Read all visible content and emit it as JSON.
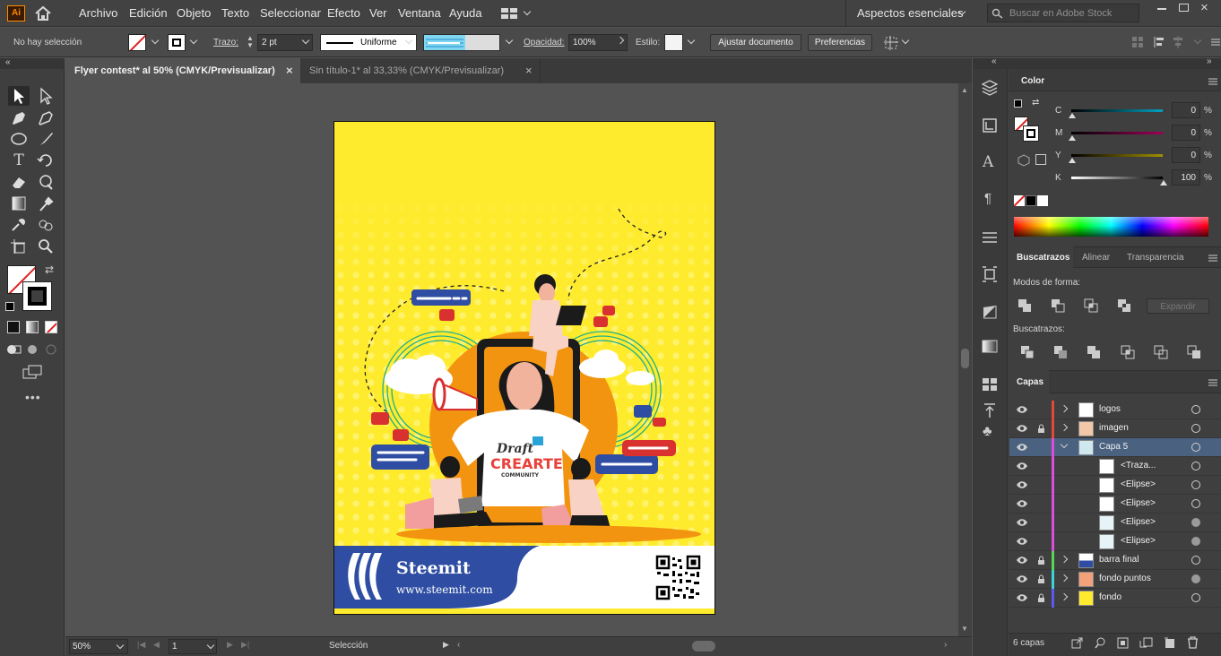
{
  "menubar": {
    "app_logo": "Ai",
    "menus": [
      "Archivo",
      "Edición",
      "Objeto",
      "Texto",
      "Seleccionar",
      "Efecto",
      "Ver",
      "Ventana",
      "Ayuda"
    ],
    "workspace": "Aspectos esenciales",
    "search_placeholder": "Buscar en Adobe Stock"
  },
  "control": {
    "selection": "No hay selección",
    "stroke_label": "Trazo:",
    "stroke_weight": "2 pt",
    "stroke_profile": "Uniforme",
    "opacity_label": "Opacidad:",
    "opacity_value": "100%",
    "style_label": "Estilo:",
    "adjust_button": "Ajustar documento",
    "prefs_button": "Preferencias"
  },
  "tabs": [
    {
      "label": "Flyer contest* al 50% (CMYK/Previsualizar)",
      "close": "×"
    },
    {
      "label": "Sin título-1* al 33,33% (CMYK/Previsualizar)",
      "close": "×"
    }
  ],
  "artwork": {
    "brand": "Steemit",
    "url": "www.steemit.com",
    "shirt_line1": "Draft",
    "shirt_line2": "CREARTE",
    "shirt_line3": "COMMUNITY"
  },
  "status": {
    "zoom": "50%",
    "page": "1",
    "tool": "Selección"
  },
  "color_panel": {
    "title": "Color",
    "channels": [
      {
        "label": "C",
        "value": "0",
        "unit": "%"
      },
      {
        "label": "M",
        "value": "0",
        "unit": "%"
      },
      {
        "label": "Y",
        "value": "0",
        "unit": "%"
      },
      {
        "label": "K",
        "value": "100",
        "unit": "%"
      }
    ]
  },
  "pathfinder": {
    "tabs": [
      "Buscatrazos",
      "Alinear",
      "Transparencia"
    ],
    "shape_modes": "Modos de forma:",
    "expand": "Expandir",
    "pathfinders": "Buscatrazos:"
  },
  "layers": {
    "title": "Capas",
    "count": "6 capas",
    "items": [
      {
        "name": "logos",
        "color": "#e04a3a"
      },
      {
        "name": "imagen",
        "color": "#e04a3a"
      },
      {
        "name": "Capa 5",
        "color": "#d94fd9"
      },
      {
        "name": "<Traza...",
        "color": "#d94fd9"
      },
      {
        "name": "<Elipse>",
        "color": "#d94fd9"
      },
      {
        "name": "<Elipse>",
        "color": "#d94fd9"
      },
      {
        "name": "<Elipse>",
        "color": "#d94fd9"
      },
      {
        "name": "<Elipse>",
        "color": "#d94fd9"
      },
      {
        "name": "barra final",
        "color": "#56d656"
      },
      {
        "name": "fondo puntos",
        "color": "#3fd2d2"
      },
      {
        "name": "fondo",
        "color": "#5a5af0"
      }
    ]
  },
  "colors": {
    "artboard_yellow": "#ffeb2d",
    "banner_blue": "#2f4ea3",
    "orange": "#f39410",
    "selected_layer": "#4a6180"
  }
}
